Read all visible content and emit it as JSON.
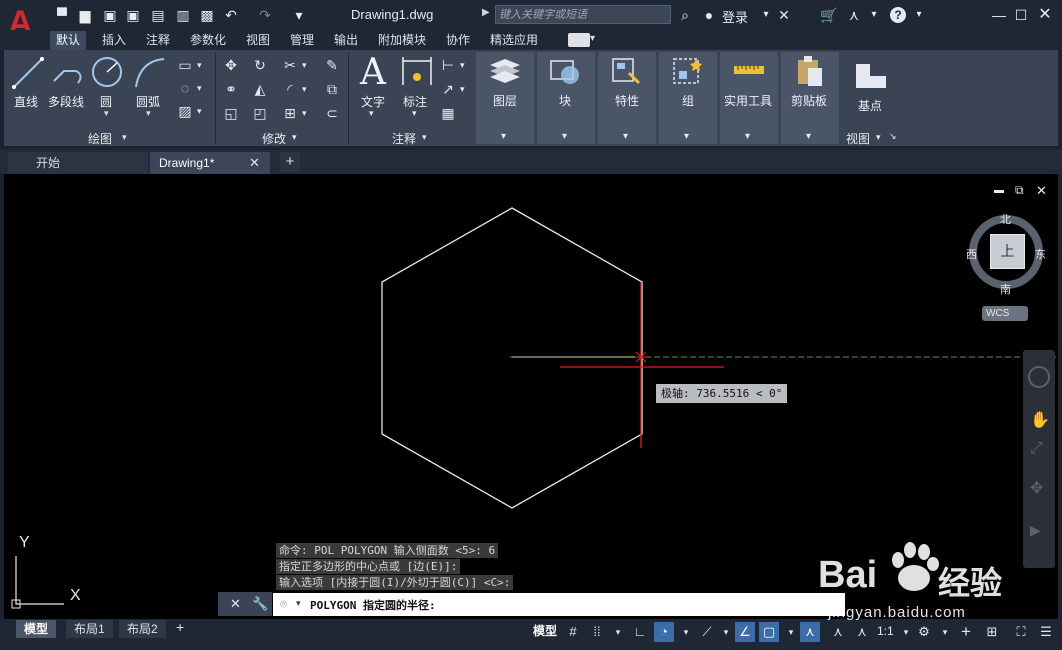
{
  "titlebar": {
    "doc_title": "Drawing1.dwg",
    "search_placeholder": "键入关键字或短语",
    "login": "登录"
  },
  "ribbon_tabs": [
    "默认",
    "插入",
    "注释",
    "参数化",
    "视图",
    "管理",
    "输出",
    "附加模块",
    "协作",
    "精选应用"
  ],
  "active_tab": "默认",
  "panels": {
    "draw": {
      "title": "绘图",
      "line": "直线",
      "polyline": "多段线",
      "circle": "圆",
      "arc": "圆弧"
    },
    "modify": {
      "title": "修改"
    },
    "annotation": {
      "title": "注释",
      "text": "文字",
      "dimension": "标注"
    },
    "layers": "图层",
    "block": "块",
    "properties": "特性",
    "groups": "组",
    "utilities": "实用工具",
    "clipboard": "剪贴板",
    "view": {
      "title": "视图",
      "base": "基点"
    }
  },
  "doc_tabs": {
    "start": "开始",
    "drawing": "Drawing1*"
  },
  "viewcube": {
    "north": "北",
    "south": "南",
    "west": "西",
    "east": "东",
    "top": "上",
    "wcs": "WCS"
  },
  "ucs": {
    "x": "X",
    "y": "Y"
  },
  "tooltip": "极轴: 736.5516 < 0°",
  "command_history": [
    "命令: POL POLYGON 输入侧面数 <5>: 6",
    "指定正多边形的中心点或 [边(E)]:",
    "输入选项 [内接于圆(I)/外切于圆(C)] <C>:"
  ],
  "command_prompt": "POLYGON 指定圆的半径:",
  "layout_tabs": [
    "模型",
    "布局1",
    "布局2"
  ],
  "status": {
    "model": "模型",
    "scale": "1:1"
  },
  "watermark": {
    "brand": "Bai",
    "brand2": "经验",
    "url": "jingyan.baidu.com"
  },
  "colors": {
    "accent": "#d8282d",
    "crosshair": "#e02020",
    "polar": "#3fa03f"
  }
}
